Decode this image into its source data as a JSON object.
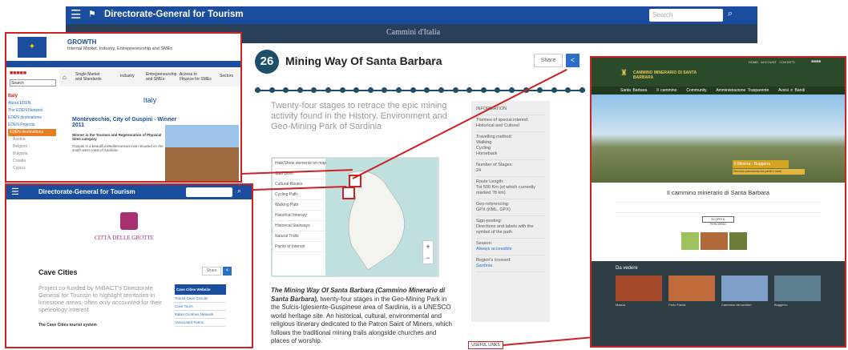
{
  "header": {
    "title": "Directorate-General for Tourism",
    "search_placeholder": "Search"
  },
  "band": {
    "logo_text": "Cammini d'Italia"
  },
  "route": {
    "number": "26",
    "title": "Mining Way Of Santa Barbara",
    "share_label": "Share",
    "lead": "Twenty-four stages to retrace the epic mining activity found in the History, Environment and Geo-Mining Park of Sardinia",
    "desc_bold": "The Mining Way Of Santa Barbara (Cammino Minerario di Santa Barbara),",
    "desc_rest": " twenty-four stages in the Geo-Mining Park in the Sulcis-Iglesiente-Guspinese area of Sardinia, is a UNESCO world heritage site. An historical, cultural, environmental and religious itinerary dedicated to the Patron Saint of Miners, which follows the traditional mining trails alongside churches and places of worship."
  },
  "legend": {
    "title": "Hide/Show elements on map",
    "items": [
      "Start point",
      "Cultural Routes",
      "Cycling Path",
      "Walking Path",
      "Historical Itinerary",
      "Historical Stairways",
      "Natural Trails",
      "Points of Interest"
    ]
  },
  "sidebar": {
    "heading": "INFORMATION",
    "themes_label": "Themes of special interest:",
    "themes_value": "Historical and Cultural",
    "travel_label": "Travelling method:",
    "travel_values": [
      "Walking",
      "Cycling",
      "Horseback"
    ],
    "stages_label": "Number of Stages:",
    "stages_value": "24",
    "length_label": "Route Length:",
    "length_value": "Tot 500 Km (of which currently marked 78 km)",
    "ref_label": "Geo-referencing:",
    "ref_value": "GPX (KML, GPX)",
    "sign_label": "Sign-posting:",
    "sign_value": "Directions and labels with the symbol of the path",
    "season_label": "Season:",
    "season_value": "Always accessible",
    "region_label": "Region's crossed:",
    "region_value": "Sardinia",
    "useful_links": "USEFUL LINKS"
  },
  "panel_growth": {
    "brand": "GROWTH",
    "subtitle": "Internal Market, Industry, Entrepreneurship and SMEs",
    "search_placeholder": "Search",
    "nav": [
      "Single Market and Standards",
      "Industry",
      "Entrepreneurship and SMEs",
      "Access to Finance for SMEs",
      "Sectors"
    ],
    "side_items": [
      "Italy",
      "About EDEN",
      "The EDEN Network",
      "EDEN destinations",
      "EDEN Projects",
      "EDEN destinations"
    ],
    "side_sub": [
      "Austria",
      "Belgium",
      "Bulgaria",
      "Croatia",
      "Cyprus"
    ],
    "heading": "Italy",
    "story_title": "Montevecchio, City of Guspini - Winner 2011",
    "story_sub": "Winner in the Tourism and Regeneration of Physical Sites category",
    "story_text": "Guspini is a beautiful Mediterranean town situated on the south-west coast of Sardinia."
  },
  "panel_caves": {
    "title": "Directorate-General for Tourism",
    "logo_text": "CITTÀ DELLE GROTTE",
    "heading": "Cave Cities",
    "share_label": "Share",
    "lead": "Project co-funded by MiBACT's Directorate General for Tourism to highlight territories in limestone areas, often only accounted for their speleology interest",
    "text_bold": "The Cave Cities tourist system",
    "links_title": "Cave Cities Website",
    "links": [
      "Tourist Cave Circuits",
      "Cave Tours",
      "Italian Grottoes Network",
      "Associated Towns"
    ]
  },
  "panel_cammino": {
    "brand": "CAMMINO MINERARIO DI SANTA BARBARA",
    "top_links": [
      "HOME",
      "ACCOUNT",
      "CONTATTI"
    ],
    "nav": [
      "Santa Barbara",
      "Il cammino",
      "Community",
      "Amministrazione Trasparente",
      "Avvisi e Bandi"
    ],
    "hero_caption": "Il Miniera - Buggerru",
    "hero_sub": "Percorso panoramico tra pareti e mare",
    "heading": "Il cammino minerario di Santa Barbara",
    "button_label": "SCOPRI IL PERCORSO",
    "gallery_title": "Da vedere",
    "gallery": [
      "Masua",
      "Porto Flavia",
      "Cammino dei sentieri",
      "Buggerru"
    ]
  },
  "colors": {
    "header": "#1a4d9e",
    "accent": "#c22",
    "badge": "#1e4f6a"
  }
}
